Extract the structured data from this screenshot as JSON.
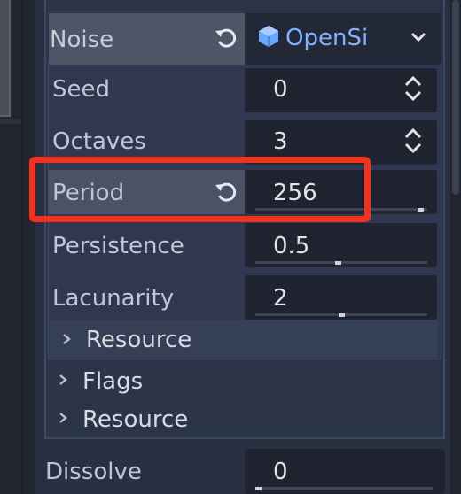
{
  "noise": {
    "label": "Noise",
    "resource_name": "OpenSi"
  },
  "properties": [
    {
      "label": "Seed",
      "value": "0"
    },
    {
      "label": "Octaves",
      "value": "3"
    },
    {
      "label": "Period",
      "value": "256"
    },
    {
      "label": "Persistence",
      "value": "0.5"
    },
    {
      "label": "Lacunarity",
      "value": "2"
    }
  ],
  "sliders": {
    "period": 0.98,
    "persistence": 0.48,
    "lacunarity": 0.5,
    "dissolve": 0.0
  },
  "sections": {
    "inner_resource": "Resource",
    "flags": "Flags",
    "outer_resource": "Resource"
  },
  "dissolve": {
    "label": "Dissolve",
    "value": "0"
  },
  "colors": {
    "highlight": "#f4311c",
    "resource_icon": "#6aa8ff",
    "resource_text": "#7fb2ff"
  }
}
